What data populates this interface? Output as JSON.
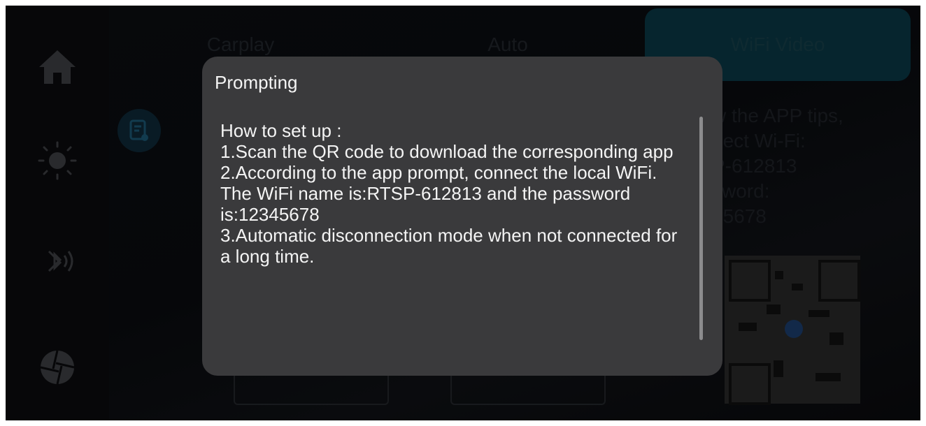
{
  "tabs": [
    {
      "label": "Carplay"
    },
    {
      "label": "Auto"
    },
    {
      "label": "WiFi Video",
      "active": true
    }
  ],
  "background": {
    "instructions_fragment": "w the APP tips,\nnect Wi-Fi:\nP-612813\nsword:\n45678"
  },
  "sidebar": {
    "items": [
      {
        "icon": "home-icon"
      },
      {
        "icon": "brightness-icon"
      },
      {
        "icon": "bluetooth-icon"
      },
      {
        "icon": "aperture-icon"
      }
    ]
  },
  "dialog": {
    "title": "Prompting",
    "body": "How to set up :\n1.Scan the QR code to download the corresponding app\n2.According to the app prompt, connect the local WiFi. The WiFi name is:RTSP-612813 and the password is:12345678\n3.Automatic disconnection mode when not connected for a long time."
  },
  "colors": {
    "dialog_bg": "#3a3a3c",
    "active_tab": "#0a3a48",
    "screen_bg": "#050607"
  }
}
